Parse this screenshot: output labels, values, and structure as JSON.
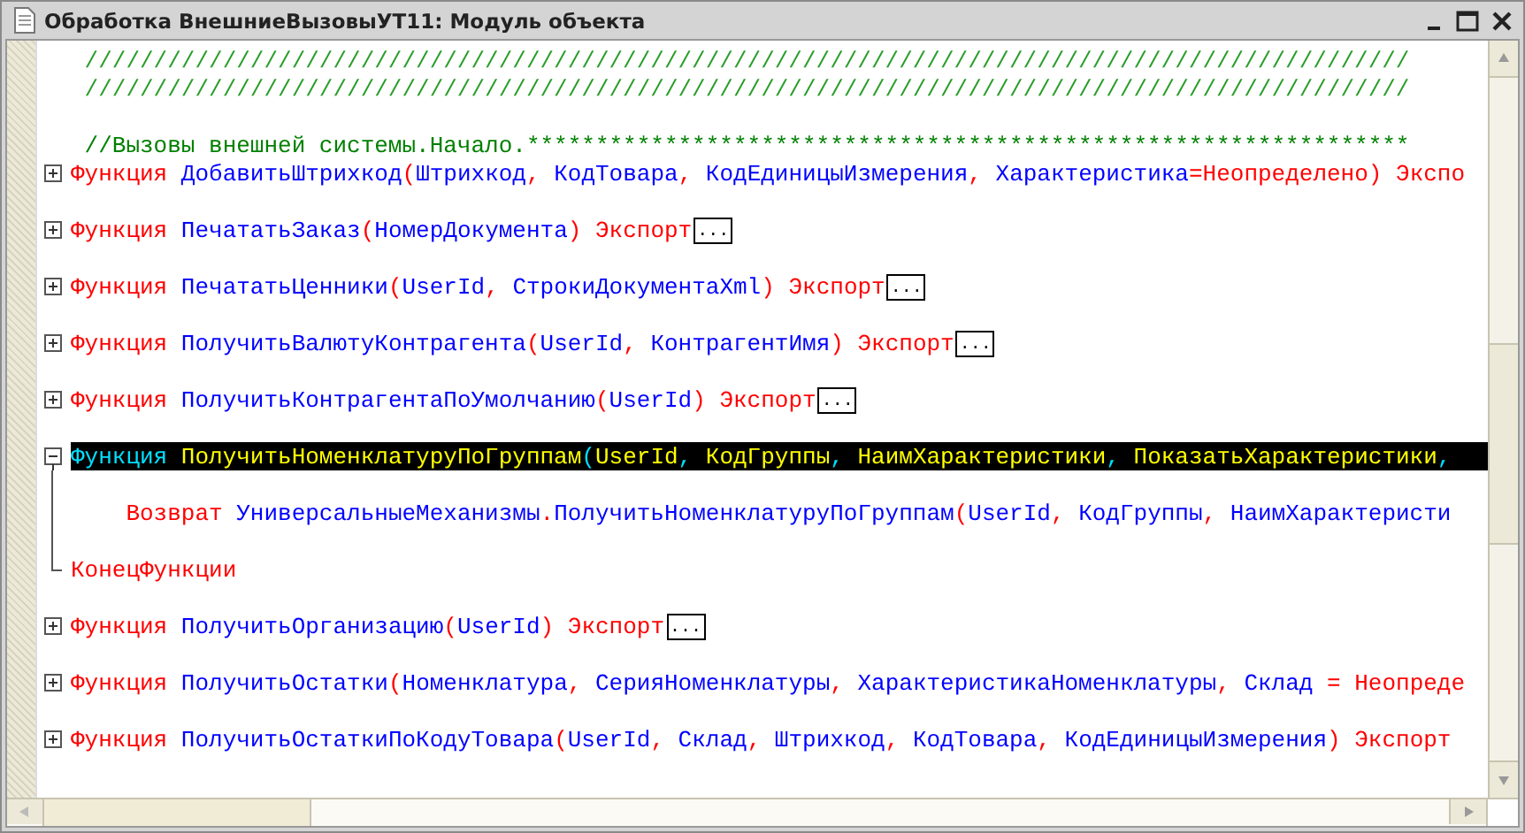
{
  "window": {
    "title": "Обработка ВнешниеВызовыУТ11: Модуль объекта"
  },
  "editor": {
    "lines": [
      {
        "kind": "plain",
        "selected": false,
        "tokens": [
          {
            "kind": "separator",
            "text": " ////////////////////////////////////////////////////////////////////////////////////////////////"
          }
        ]
      },
      {
        "kind": "plain",
        "selected": false,
        "tokens": [
          {
            "kind": "separator",
            "text": " ////////////////////////////////////////////////////////////////////////////////////////////////"
          }
        ]
      },
      {
        "kind": "blank"
      },
      {
        "kind": "plain",
        "selected": false,
        "tokens": [
          {
            "kind": "comment",
            "text": " //Вызовы внешней системы.Начало.****************************************************************"
          }
        ]
      },
      {
        "kind": "collapsed_function",
        "selected": false,
        "tokens": [
          {
            "kind": "keyword",
            "text": "Функция "
          },
          {
            "kind": "ident",
            "text": "ДобавитьШтрихкод"
          },
          {
            "kind": "punct",
            "text": "("
          },
          {
            "kind": "ident",
            "text": "Штрихкод"
          },
          {
            "kind": "punct",
            "text": ", "
          },
          {
            "kind": "ident",
            "text": "КодТовара"
          },
          {
            "kind": "punct",
            "text": ", "
          },
          {
            "kind": "ident",
            "text": "КодЕдиницыИзмерения"
          },
          {
            "kind": "punct",
            "text": ", "
          },
          {
            "kind": "ident",
            "text": "Характеристика"
          },
          {
            "kind": "punct",
            "text": "="
          },
          {
            "kind": "keyword",
            "text": "Неопределено"
          },
          {
            "kind": "punct",
            "text": ") "
          },
          {
            "kind": "keyword",
            "text": "Экспо"
          }
        ]
      },
      {
        "kind": "blank"
      },
      {
        "kind": "collapsed_function",
        "selected": false,
        "tokens": [
          {
            "kind": "keyword",
            "text": "Функция "
          },
          {
            "kind": "ident",
            "text": "ПечататьЗаказ"
          },
          {
            "kind": "punct",
            "text": "("
          },
          {
            "kind": "ident",
            "text": "НомерДокумента"
          },
          {
            "kind": "punct",
            "text": ") "
          },
          {
            "kind": "keyword",
            "text": "Экспорт"
          },
          {
            "kind": "collapsed",
            "text": "..."
          }
        ]
      },
      {
        "kind": "blank"
      },
      {
        "kind": "collapsed_function",
        "selected": false,
        "tokens": [
          {
            "kind": "keyword",
            "text": "Функция "
          },
          {
            "kind": "ident",
            "text": "ПечататьЦенники"
          },
          {
            "kind": "punct",
            "text": "("
          },
          {
            "kind": "ident",
            "text": "UserId"
          },
          {
            "kind": "punct",
            "text": ", "
          },
          {
            "kind": "ident",
            "text": "СтрокиДокументаXml"
          },
          {
            "kind": "punct",
            "text": ") "
          },
          {
            "kind": "keyword",
            "text": "Экспорт"
          },
          {
            "kind": "collapsed",
            "text": "..."
          }
        ]
      },
      {
        "kind": "blank"
      },
      {
        "kind": "collapsed_function",
        "selected": false,
        "tokens": [
          {
            "kind": "keyword",
            "text": "Функция "
          },
          {
            "kind": "ident",
            "text": "ПолучитьВалютуКонтрагента"
          },
          {
            "kind": "punct",
            "text": "("
          },
          {
            "kind": "ident",
            "text": "UserId"
          },
          {
            "kind": "punct",
            "text": ", "
          },
          {
            "kind": "ident",
            "text": "КонтрагентИмя"
          },
          {
            "kind": "punct",
            "text": ") "
          },
          {
            "kind": "keyword",
            "text": "Экспорт"
          },
          {
            "kind": "collapsed",
            "text": "..."
          }
        ]
      },
      {
        "kind": "blank"
      },
      {
        "kind": "collapsed_function",
        "selected": false,
        "tokens": [
          {
            "kind": "keyword",
            "text": "Функция "
          },
          {
            "kind": "ident",
            "text": "ПолучитьКонтрагентаПоУмолчанию"
          },
          {
            "kind": "punct",
            "text": "("
          },
          {
            "kind": "ident",
            "text": "UserId"
          },
          {
            "kind": "punct",
            "text": ") "
          },
          {
            "kind": "keyword",
            "text": "Экспорт"
          },
          {
            "kind": "collapsed",
            "text": "..."
          }
        ]
      },
      {
        "kind": "blank"
      },
      {
        "kind": "expanded_function",
        "selected": true,
        "tokens": [
          {
            "kind": "keyword",
            "text": "Функция "
          },
          {
            "kind": "ident",
            "text": "ПолучитьНоменклатуруПоГруппам"
          },
          {
            "kind": "punct",
            "text": "("
          },
          {
            "kind": "ident",
            "text": "UserId"
          },
          {
            "kind": "punct",
            "text": ", "
          },
          {
            "kind": "ident",
            "text": "КодГруппы"
          },
          {
            "kind": "punct",
            "text": ", "
          },
          {
            "kind": "ident",
            "text": "НаимХарактеристики"
          },
          {
            "kind": "punct",
            "text": ", "
          },
          {
            "kind": "ident",
            "text": "ПоказатьХарактеристики"
          },
          {
            "kind": "punct",
            "text": ","
          }
        ]
      },
      {
        "kind": "blank_inside"
      },
      {
        "kind": "inside",
        "selected": false,
        "tokens": [
          {
            "kind": "keyword",
            "text": "    Возврат "
          },
          {
            "kind": "ident",
            "text": "УниверсальныеМеханизмы"
          },
          {
            "kind": "punct",
            "text": "."
          },
          {
            "kind": "ident",
            "text": "ПолучитьНоменклатуруПоГруппам"
          },
          {
            "kind": "punct",
            "text": "("
          },
          {
            "kind": "ident",
            "text": "UserId"
          },
          {
            "kind": "punct",
            "text": ", "
          },
          {
            "kind": "ident",
            "text": "КодГруппы"
          },
          {
            "kind": "punct",
            "text": ", "
          },
          {
            "kind": "ident",
            "text": "НаимХарактеристи"
          }
        ]
      },
      {
        "kind": "blank_inside"
      },
      {
        "kind": "end",
        "selected": false,
        "tokens": [
          {
            "kind": "keyword",
            "text": "КонецФункции"
          }
        ]
      },
      {
        "kind": "blank"
      },
      {
        "kind": "collapsed_function",
        "selected": false,
        "tokens": [
          {
            "kind": "keyword",
            "text": "Функция "
          },
          {
            "kind": "ident",
            "text": "ПолучитьОрганизацию"
          },
          {
            "kind": "punct",
            "text": "("
          },
          {
            "kind": "ident",
            "text": "UserId"
          },
          {
            "kind": "punct",
            "text": ") "
          },
          {
            "kind": "keyword",
            "text": "Экспорт"
          },
          {
            "kind": "collapsed",
            "text": "..."
          }
        ]
      },
      {
        "kind": "blank"
      },
      {
        "kind": "collapsed_function",
        "selected": false,
        "tokens": [
          {
            "kind": "keyword",
            "text": "Функция "
          },
          {
            "kind": "ident",
            "text": "ПолучитьОстатки"
          },
          {
            "kind": "punct",
            "text": "("
          },
          {
            "kind": "ident",
            "text": "Номенклатура"
          },
          {
            "kind": "punct",
            "text": ", "
          },
          {
            "kind": "ident",
            "text": "СерияНоменклатуры"
          },
          {
            "kind": "punct",
            "text": ", "
          },
          {
            "kind": "ident",
            "text": "ХарактеристикаНоменклатуры"
          },
          {
            "kind": "punct",
            "text": ", "
          },
          {
            "kind": "ident",
            "text": "Склад "
          },
          {
            "kind": "punct",
            "text": "= "
          },
          {
            "kind": "keyword",
            "text": "Неопреде"
          }
        ]
      },
      {
        "kind": "blank"
      },
      {
        "kind": "collapsed_function",
        "selected": false,
        "tokens": [
          {
            "kind": "keyword",
            "text": "Функция "
          },
          {
            "kind": "ident",
            "text": "ПолучитьОстаткиПоКодуТовара"
          },
          {
            "kind": "punct",
            "text": "("
          },
          {
            "kind": "ident",
            "text": "UserId"
          },
          {
            "kind": "punct",
            "text": ", "
          },
          {
            "kind": "ident",
            "text": "Склад"
          },
          {
            "kind": "punct",
            "text": ", "
          },
          {
            "kind": "ident",
            "text": "Штрихкод"
          },
          {
            "kind": "punct",
            "text": ", "
          },
          {
            "kind": "ident",
            "text": "КодТовара"
          },
          {
            "kind": "punct",
            "text": ", "
          },
          {
            "kind": "ident",
            "text": "КодЕдиницыИзмерения"
          },
          {
            "kind": "punct",
            "text": ") "
          },
          {
            "kind": "keyword",
            "text": "Экспорт"
          }
        ]
      }
    ]
  }
}
